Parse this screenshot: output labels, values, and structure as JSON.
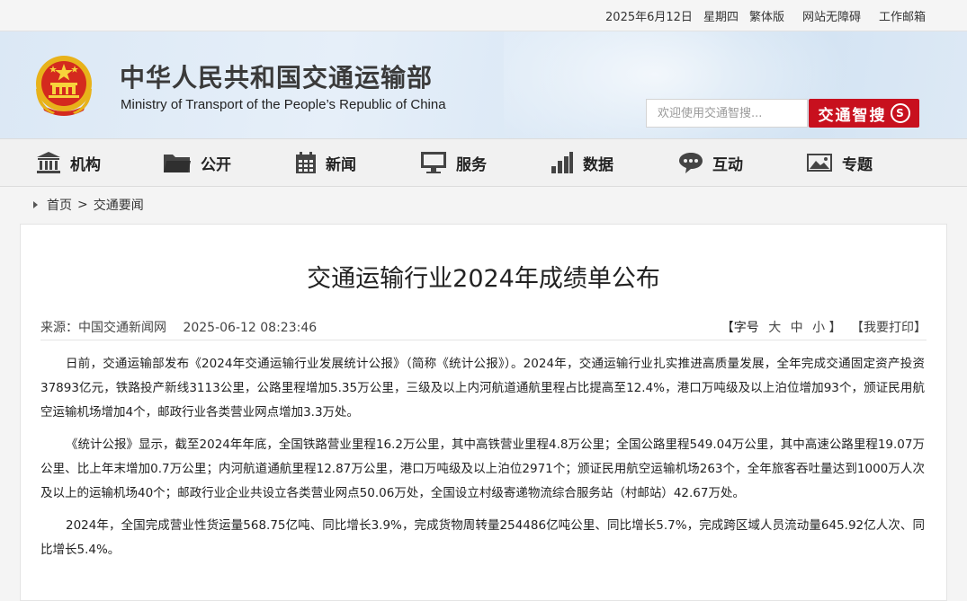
{
  "topbar": {
    "date": "2025年6月12日",
    "weekday": "星期四",
    "traditional": "繁体版",
    "accessibility": "网站无障碍",
    "mail": "工作邮箱"
  },
  "header": {
    "title": "中华人民共和国交通运输部",
    "subtitle": "Ministry of Transport of the People’s Republic of China",
    "search_placeholder": "欢迎使用交通智搜...",
    "search_button": "交通智搜"
  },
  "nav": [
    {
      "label": "机构",
      "icon": "institution-icon"
    },
    {
      "label": "公开",
      "icon": "folder-icon"
    },
    {
      "label": "新闻",
      "icon": "calendar-icon"
    },
    {
      "label": "服务",
      "icon": "monitor-icon"
    },
    {
      "label": "数据",
      "icon": "bar-chart-icon"
    },
    {
      "label": "互动",
      "icon": "chat-icon"
    },
    {
      "label": "专题",
      "icon": "picture-icon"
    }
  ],
  "breadcrumb": {
    "home": "首页",
    "separator": ">",
    "current": "交通要闻"
  },
  "article": {
    "title": "交通运输行业2024年成绩单公布",
    "source": "来源：中国交通新闻网",
    "datetime": "2025-06-12 08:23:46",
    "font_label": "【字号",
    "font_large": "大",
    "font_medium": "中",
    "font_small": "小",
    "font_close": "】",
    "print": "【我要打印】",
    "paragraphs": [
      "日前，交通运输部发布《2024年交通运输行业发展统计公报》（简称《统计公报》）。2024年，交通运输行业扎实推进高质量发展，全年完成交通固定资产投资37893亿元，铁路投产新线3113公里，公路里程增加5.35万公里，三级及以上内河航道通航里程占比提高至12.4%，港口万吨级及以上泊位增加93个，颁证民用航空运输机场增加4个，邮政行业各类营业网点增加3.3万处。",
      "《统计公报》显示，截至2024年年底，全国铁路营业里程16.2万公里，其中高铁营业里程4.8万公里；全国公路里程549.04万公里，其中高速公路里程19.07万公里、比上年末增加0.7万公里；内河航道通航里程12.87万公里，港口万吨级及以上泊位2971个；颁证民用航空运输机场263个，全年旅客吞吐量达到1000万人次及以上的运输机场40个；邮政行业企业共设立各类营业网点50.06万处，全国设立村级寄递物流综合服务站（村邮站）42.67万处。",
      "2024年，全国完成营业性货运量568.75亿吨、同比增长3.9%，完成货物周转量254486亿吨公里、同比增长5.7%，完成跨区域人员流动量645.92亿人次、同比增长5.4%。"
    ]
  },
  "colors": {
    "accent": "#c8101e",
    "header_bg": "#dbe8f5",
    "nav_bg": "#f1f1f1"
  }
}
